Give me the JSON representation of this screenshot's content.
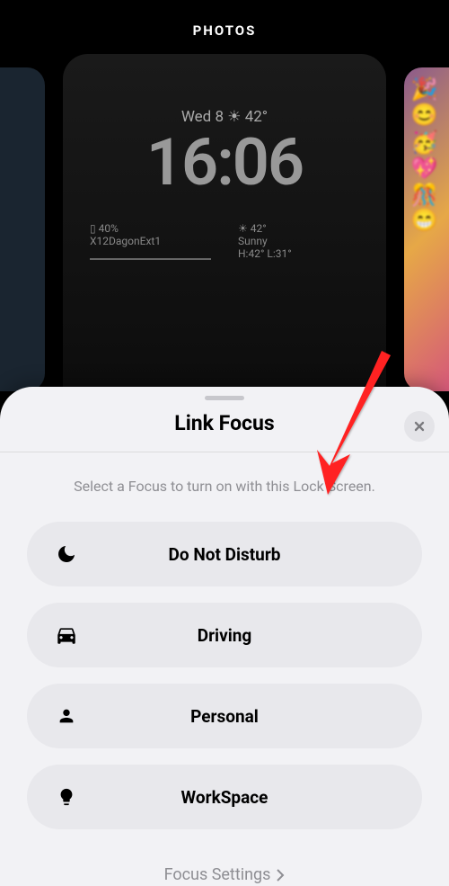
{
  "top": {
    "photosLabel": "PHOTOS",
    "wallpaper": {
      "date": "Wed 8 ☀ 42°",
      "time": "16:06",
      "battery": "▯ 40%",
      "batteryLabel": "X12DagonExt1",
      "weatherTemp": "☀ 42°",
      "weatherDesc": "Sunny",
      "weatherRange": "H:42° L:31°"
    }
  },
  "sheet": {
    "title": "Link Focus",
    "subtitle": "Select a Focus to turn on with this Lock Screen.",
    "items": [
      {
        "label": "Do Not Disturb",
        "icon": "moon"
      },
      {
        "label": "Driving",
        "icon": "car"
      },
      {
        "label": "Personal",
        "icon": "person"
      },
      {
        "label": "WorkSpace",
        "icon": "bulb"
      }
    ],
    "footerLink": "Focus Settings"
  }
}
